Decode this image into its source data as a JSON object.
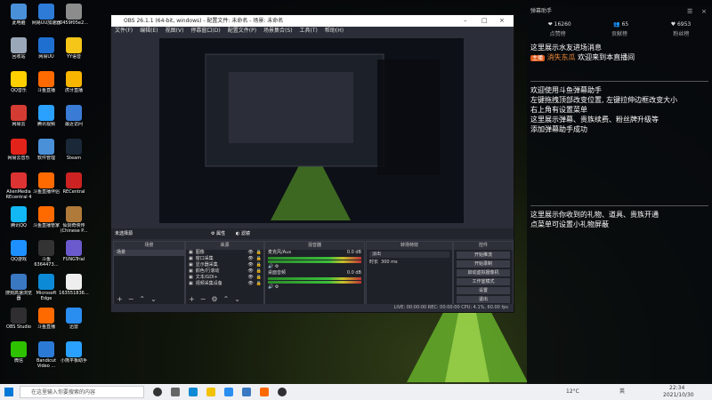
{
  "desktop": {
    "icons": [
      {
        "label": "此电脑",
        "color": "#4a90d9"
      },
      {
        "label": "网易UU加速器",
        "color": "#2d7bd6"
      },
      {
        "label": "0459f05e2...",
        "color": "#8c8c8c"
      },
      {
        "label": "回收站",
        "color": "#9aa7b8"
      },
      {
        "label": "网易UU",
        "color": "#1f6fd1"
      },
      {
        "label": "YY语音",
        "color": "#f5c518"
      },
      {
        "label": "QQ音乐",
        "color": "#ffd000"
      },
      {
        "label": "斗鱼直播",
        "color": "#ff6a00"
      },
      {
        "label": "虎牙直播",
        "color": "#f7b500"
      },
      {
        "label": "网易云",
        "color": "#d43c33"
      },
      {
        "label": "腾讯视频",
        "color": "#2aa1ff"
      },
      {
        "label": "最近访问",
        "color": "#3a7bd5"
      },
      {
        "label": "网易云音乐",
        "color": "#e2231a"
      },
      {
        "label": "软件管理",
        "color": "#4a90d9"
      },
      {
        "label": "Steam",
        "color": "#1b2838"
      },
      {
        "label": "AlienMedia REcentral 4",
        "color": "#d33"
      },
      {
        "label": "斗鱼直播伴侣",
        "color": "#ff6a00"
      },
      {
        "label": "RECentral",
        "color": "#c22"
      },
      {
        "label": "腾讯QQ",
        "color": "#12b7f5"
      },
      {
        "label": "斗鱼直播管家",
        "color": "#ff6a00"
      },
      {
        "label": "仙剑奇侠传 (Chinese P...",
        "color": "#b07a3a"
      },
      {
        "label": "QQ游戏",
        "color": "#1e90ff"
      },
      {
        "label": "斗鱼 6364473…",
        "color": "#333333"
      },
      {
        "label": "FUNGTrial",
        "color": "#6a5acd"
      },
      {
        "label": "搜狗高速浏览器",
        "color": "#3a78c2"
      },
      {
        "label": "Microsoft Edge",
        "color": "#0c8ad6"
      },
      {
        "label": "163551836…",
        "color": "#eeeeee"
      },
      {
        "label": "OBS Studio",
        "color": "#302e31"
      },
      {
        "label": "斗鱼直播",
        "color": "#ff6a00"
      },
      {
        "label": "迅雷",
        "color": "#2a8df0"
      },
      {
        "label": "微信",
        "color": "#2dc100"
      },
      {
        "label": "Bandicut Video ...",
        "color": "#2b7bd6"
      },
      {
        "label": "小熊平板助手",
        "color": "#2aa1ff"
      }
    ]
  },
  "obs": {
    "title": "OBS 26.1.1 (64-bit, windows) - 配置文件: 未命名 - 场景: 未命名",
    "menu": [
      "文件(F)",
      "编辑(E)",
      "视图(V)",
      "停靠窗口(D)",
      "配置文件(P)",
      "场景集合(S)",
      "工具(T)",
      "帮助(H)"
    ],
    "source_bar": {
      "label": "未选择源",
      "props": "属性",
      "filters": "滤镜"
    },
    "scenes": {
      "title": "场景",
      "items": [
        "场景"
      ]
    },
    "sources": {
      "title": "来源",
      "items": [
        "图像",
        "窗口采集",
        "显示器采集",
        "颜色/行滚动",
        "文本/GDI+",
        "视频采集设备"
      ]
    },
    "mixer": {
      "title": "混音器",
      "tracks": [
        {
          "name": "麦克风/Aux",
          "db": "0.0 dB"
        },
        {
          "name": "桌面音频",
          "db": "0.0 dB"
        }
      ]
    },
    "transitions": {
      "title": "转场特效",
      "type": "淡出",
      "duration_label": "时长",
      "duration": "300 ms"
    },
    "controls": {
      "title": "控件",
      "buttons": [
        "开始推流",
        "开始录制",
        "启动虚拟摄像机",
        "工作室模式",
        "设置",
        "退出"
      ]
    },
    "status": "LIVE: 00:00:00   REC: 00:00:00   CPU: 4.1%, 60.00 fps"
  },
  "danmu": {
    "title": "弹幕助手",
    "stats": [
      "16260",
      "65",
      "6953"
    ],
    "tabs": [
      "点赞榜",
      "贡献榜",
      "粉丝榜"
    ],
    "welcome_line": "这里展示水友进场消息",
    "badge": "主播",
    "user": "消失东瓜",
    "welcome_text": "欢迎来到本直播间",
    "help_lines": [
      "欢迎使用斗鱼弹幕助手",
      "左键拖拽顶部改变位置, 左键拉伸边框改变大小",
      "右上角有设置菜单",
      "这里展示弹幕、贵族续费、粉丝牌升级等",
      "添加弹幕助手成功"
    ],
    "gift_lines": [
      "这里展示你收到的礼物、道具、贵族开通",
      "点菜单可设置小礼物屏蔽"
    ]
  },
  "taskbar": {
    "search_placeholder": "在这里输入你要搜索的内容",
    "weather": "12°C",
    "lang": "英",
    "time": "22:34",
    "date": "2021/10/30"
  }
}
